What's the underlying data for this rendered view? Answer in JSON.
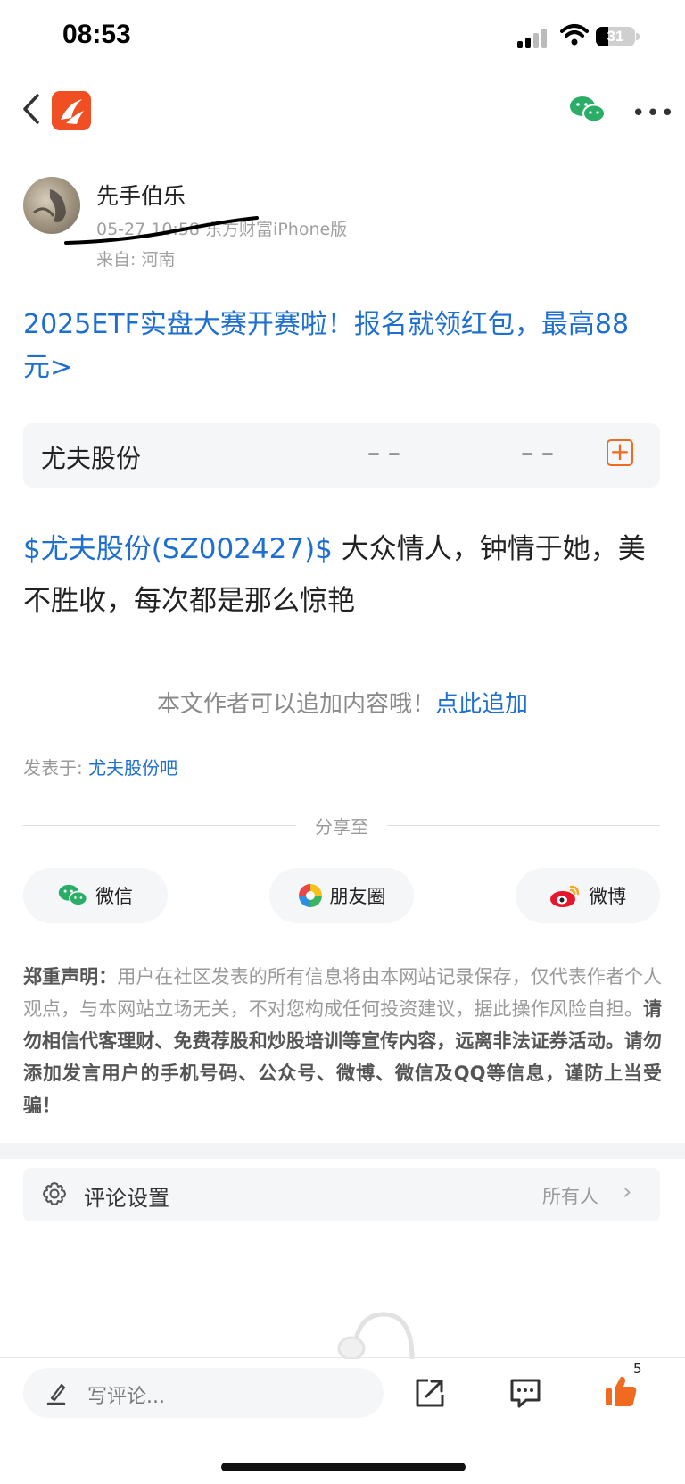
{
  "status_bar": {
    "time": "08:53",
    "battery": "31"
  },
  "nav": {
    "back_icon": "chevron-left-icon",
    "app_icon": "eastmoney-logo",
    "wechat_icon": "wechat-icon",
    "more_icon": "more-dots-icon"
  },
  "author": {
    "name": "先手伯乐",
    "meta": "05-27 10:58 东方财富iPhone版",
    "from": "来自: 河南"
  },
  "promo": {
    "text": "2025ETF实盘大赛开赛啦！报名就领红包，最高88元>"
  },
  "stock_card": {
    "name": "尤夫股份",
    "price": "– –",
    "change": "– –",
    "add_icon": "plus-square-icon"
  },
  "post": {
    "tag": "$尤夫股份(SZ002427)$",
    "text": " 大众情人，钟情于她，美不胜收，每次都是那么惊艳"
  },
  "add_more": {
    "text": "本文作者可以追加内容哦！",
    "link": "点此追加"
  },
  "posted_in": {
    "label": "发表于: ",
    "forum": "尤夫股份吧"
  },
  "share": {
    "title": "分享至",
    "buttons": [
      {
        "label": "微信",
        "icon": "wechat-icon"
      },
      {
        "label": "朋友圈",
        "icon": "moments-icon"
      },
      {
        "label": "微博",
        "icon": "weibo-icon"
      }
    ]
  },
  "disclaimer": {
    "title": "郑重声明：",
    "normal": "用户在社区发表的所有信息将由本网站记录保存，仅代表作者个人观点，与本网站立场无关，不对您构成任何投资建议，据此操作风险自担。",
    "bold": "请勿相信代客理财、免费荐股和炒股培训等宣传内容，远离非法证券活动。请勿添加发言用户的手机号码、公众号、微博、微信及QQ等信息，谨防上当受骗！"
  },
  "comment_settings": {
    "label": "评论设置",
    "value": "所有人",
    "icon": "gear-icon"
  },
  "bottom_bar": {
    "placeholder": "写评论...",
    "like_count": "5",
    "icons": [
      "pencil-icon",
      "share-icon",
      "comment-icon",
      "thumbs-up-icon"
    ]
  },
  "colors": {
    "accent_blue": "#1e6fd0",
    "brand_orange": "#f04e23"
  }
}
